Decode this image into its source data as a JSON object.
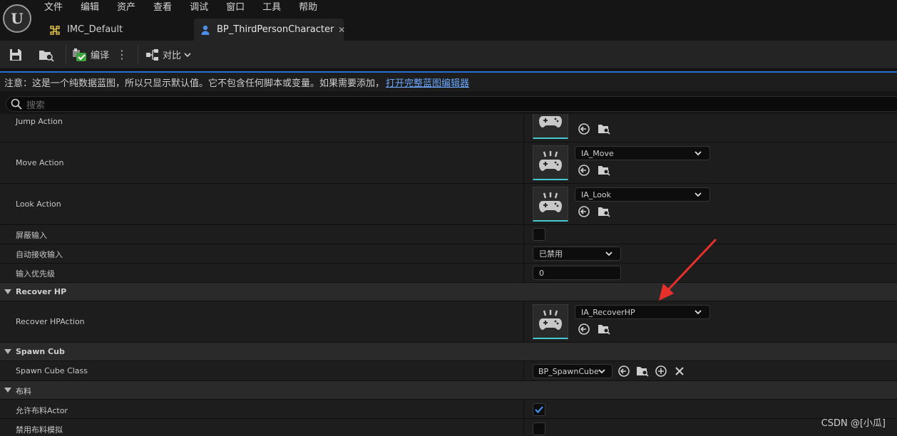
{
  "menu": [
    "文件",
    "编辑",
    "资产",
    "查看",
    "调试",
    "窗口",
    "工具",
    "帮助"
  ],
  "logo_letter": "U",
  "tabs": [
    {
      "label": "IMC_Default",
      "icon": "input-mapping-icon"
    },
    {
      "label": "BP_ThirdPersonCharacter",
      "icon": "person-icon"
    }
  ],
  "toolbar": {
    "compile_label": "编译",
    "diff_label": "对比"
  },
  "notice": {
    "text": "注意：这是一个纯数据蓝图，所以只显示默认值。它不包含任何脚本或变量。如果需要添加，",
    "link": "打开完整蓝图编辑器"
  },
  "search": {
    "placeholder": "搜索"
  },
  "rows": {
    "jump": {
      "label": "Jump Action"
    },
    "move": {
      "label": "Move Action",
      "value": "IA_Move"
    },
    "look": {
      "label": "Look Action",
      "value": "IA_Look"
    },
    "block_input": {
      "label": "屏蔽输入"
    },
    "auto_receive": {
      "label": "自动接收输入",
      "value": "已禁用"
    },
    "input_priority": {
      "label": "输入优先级",
      "value": "0"
    },
    "cat_recover": {
      "label": "Recover HP"
    },
    "recover_action": {
      "label": "Recover HPAction",
      "value": "IA_RecoverHP"
    },
    "cat_spawn": {
      "label": "Spawn Cub"
    },
    "spawn_class": {
      "label": "Spawn Cube Class",
      "value": "BP_SpawnCube"
    },
    "cat_cloth": {
      "label": "布料"
    },
    "allow_cloth": {
      "label": "允许布料Actor",
      "checked": true
    },
    "disable_cloth_sim": {
      "label": "禁用布料模拟",
      "checked": false
    }
  },
  "watermark": "CSDN @[小瓜]",
  "colors": {
    "accent": "#2a6ed8",
    "link": "#6aa8ff",
    "thumb_underline": "#48c8d0",
    "annotation_arrow": "#e8302a"
  }
}
